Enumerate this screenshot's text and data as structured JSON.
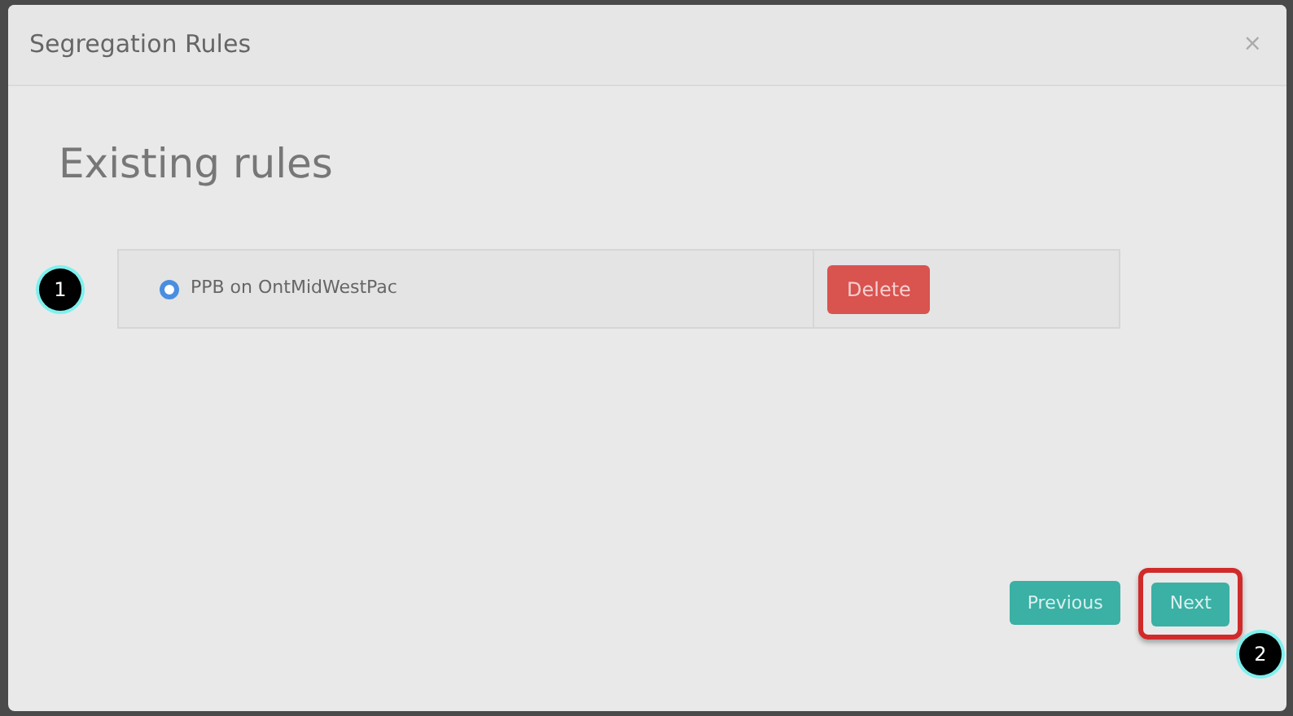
{
  "dialog": {
    "title": "Segregation Rules",
    "close": "×"
  },
  "heading": "Existing rules",
  "rules": [
    {
      "label": "PPB on OntMidWestPac",
      "selected": true,
      "action": "Delete"
    }
  ],
  "footer_buttons": [
    {
      "label": "Previous",
      "highlighted": false
    },
    {
      "label": "Next",
      "highlighted": true
    }
  ],
  "rules_callout": "1",
  "footer_callout": "2"
}
